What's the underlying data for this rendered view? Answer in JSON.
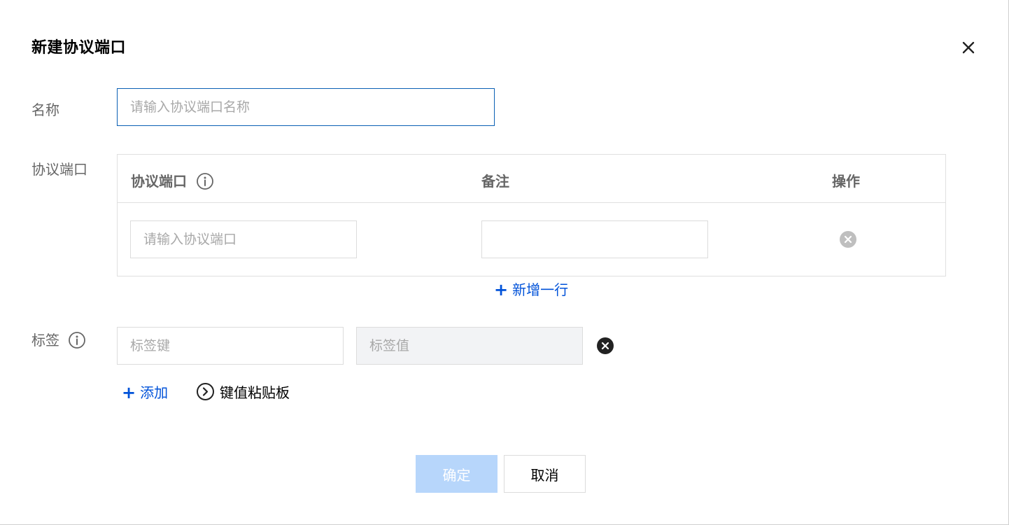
{
  "dialog": {
    "title": "新建协议端口"
  },
  "form": {
    "name_label": "名称",
    "name_placeholder": "请输入协议端口名称",
    "ports_label": "协议端口",
    "tags_label": "标签"
  },
  "ports_table": {
    "columns": [
      "协议端口",
      "备注",
      "操作"
    ],
    "rows": [
      {
        "port_placeholder": "请输入协议端口",
        "note_value": ""
      }
    ],
    "add_row_label": "新增一行"
  },
  "tags": {
    "key_placeholder": "标签键",
    "value_placeholder": "标签值",
    "add_label": "添加",
    "clipboard_label": "键值粘贴板"
  },
  "footer": {
    "confirm_label": "确定",
    "cancel_label": "取消"
  },
  "colors": {
    "accent": "#0052d9",
    "focus_border": "#0a5fb4",
    "confirm_disabled_bg": "#b7d6fb"
  },
  "icons": {
    "close": "close-icon",
    "info": "info-icon",
    "remove": "remove-circle-icon",
    "chevron": "chevron-right-circle-icon",
    "plus": "plus-icon"
  }
}
